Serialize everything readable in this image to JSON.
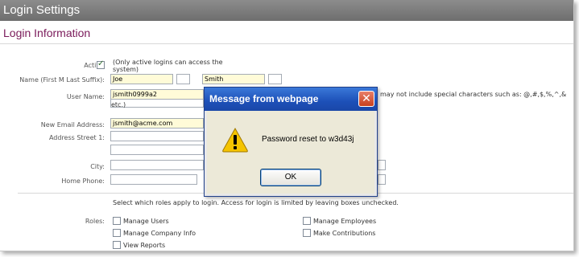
{
  "window": {
    "title": "Login Settings"
  },
  "section": {
    "title": "Login Information"
  },
  "form": {
    "active_label": "Active",
    "active_checked": true,
    "active_note": "(Only active logins can access the system)",
    "name_label": "Name (First M Last Suffix):",
    "first_name": "Joe",
    "middle_initial": "",
    "last_name": "Smith",
    "suffix": "",
    "username_label": "User Name:",
    "username": "jsmith0999a2",
    "username_note": "may not include special characters such as: @,#,$,%,^,&",
    "username_note_2": "etc.)",
    "email_label": "New Email Address:",
    "email": "jsmith@acme.com",
    "address1_label": "Address Street 1:",
    "address1": "",
    "address2": "",
    "city_label": "City:",
    "city": "",
    "phone_label": "Home Phone:",
    "phone": ""
  },
  "roles": {
    "intro": "Select which roles apply to login. Access for login is limited by leaving boxes unchecked.",
    "label": "Roles:",
    "items": [
      {
        "label": "Manage Users",
        "checked": false
      },
      {
        "label": "Manage Employees",
        "checked": false
      },
      {
        "label": "Manage Company Info",
        "checked": false
      },
      {
        "label": "Make Contributions",
        "checked": false
      },
      {
        "label": "View Reports",
        "checked": false
      }
    ]
  },
  "dialog": {
    "title": "Message from webpage",
    "message": "Password reset to w3d43j",
    "ok_label": "OK",
    "icon": "warning-icon",
    "colors": {
      "titlebar": "#1d50b8",
      "close": "#c8401e"
    }
  }
}
